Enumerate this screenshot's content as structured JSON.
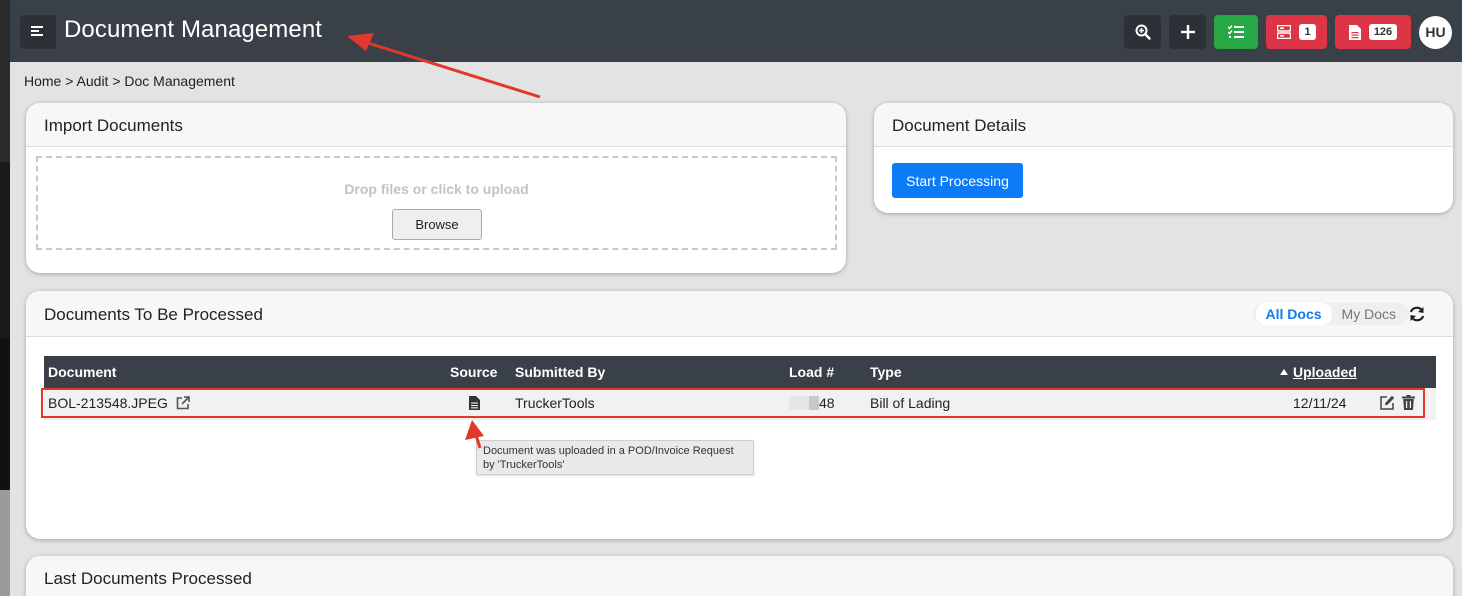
{
  "header": {
    "title": "Document Management",
    "tasks_count": "1",
    "docs_count": "126",
    "avatar_initials": "HU"
  },
  "breadcrumb": "Home > Audit > Doc Management",
  "import": {
    "title": "Import Documents",
    "drop_text": "Drop files or click to upload",
    "browse_label": "Browse"
  },
  "details": {
    "title": "Document Details",
    "start_label": "Start Processing"
  },
  "docs": {
    "title": "Documents To Be Processed",
    "toggle": {
      "all": "All Docs",
      "mine": "My Docs"
    },
    "columns": {
      "document": "Document",
      "source": "Source",
      "submitted_by": "Submitted By",
      "load": "Load #",
      "type": "Type",
      "uploaded": "Uploaded"
    },
    "rows": [
      {
        "document": "BOL-213548.JPEG",
        "submitted_by": "TruckerTools",
        "load_suffix": "48",
        "type": "Bill of Lading",
        "uploaded": "12/11/24"
      }
    ],
    "tooltip": "Document was uploaded in a POD/Invoice Request by 'TruckerTools'"
  },
  "last": {
    "title": "Last Documents Processed"
  },
  "colors": {
    "navbar": "#3a4047",
    "primary": "#0d7bf5",
    "success": "#28a745",
    "danger": "#dc3545",
    "annotation": "#e0382b"
  },
  "icons": [
    "menu-icon",
    "zoom-in-icon",
    "plus-icon",
    "checklist-icon",
    "tasks-icon",
    "document-icon",
    "external-link-icon",
    "file-icon",
    "sort-up-icon",
    "edit-icon",
    "trash-icon",
    "refresh-icon"
  ]
}
